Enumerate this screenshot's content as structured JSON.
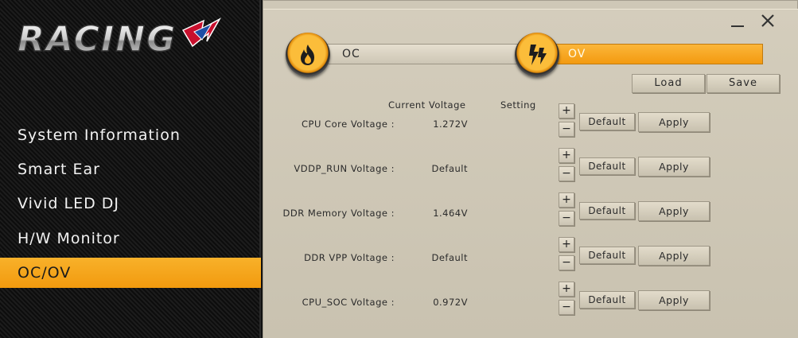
{
  "sidebar": {
    "logo_text": "RACING",
    "items": [
      {
        "label": "System Information",
        "active": false
      },
      {
        "label": "Smart Ear",
        "active": false
      },
      {
        "label": "Vivid LED DJ",
        "active": false
      },
      {
        "label": "H/W Monitor",
        "active": false
      },
      {
        "label": "OC/OV",
        "active": true
      }
    ]
  },
  "window": {
    "minimize_icon": "minimize-icon",
    "close_icon": "close-icon"
  },
  "tabs": [
    {
      "label": "OC",
      "icon": "flame-icon",
      "active": false
    },
    {
      "label": "OV",
      "icon": "lightning-icon",
      "active": true
    }
  ],
  "toolbar": {
    "load_label": "Load",
    "save_label": "Save"
  },
  "columns": {
    "current": "Current Voltage",
    "setting": "Setting"
  },
  "rows": [
    {
      "label": "CPU Core Voltage :",
      "current": "1.272V"
    },
    {
      "label": "VDDP_RUN Voltage :",
      "current": "Default"
    },
    {
      "label": "DDR Memory Voltage :",
      "current": "1.464V"
    },
    {
      "label": "DDR VPP Voltage :",
      "current": "Default"
    },
    {
      "label": "CPU_SOC Voltage :",
      "current": "0.972V"
    }
  ],
  "row_buttons": {
    "plus": "+",
    "minus": "−",
    "default": "Default",
    "apply": "Apply"
  },
  "colors": {
    "accent": "#f5a21a",
    "panel": "#cfc8b7",
    "sidebar": "#141414"
  }
}
